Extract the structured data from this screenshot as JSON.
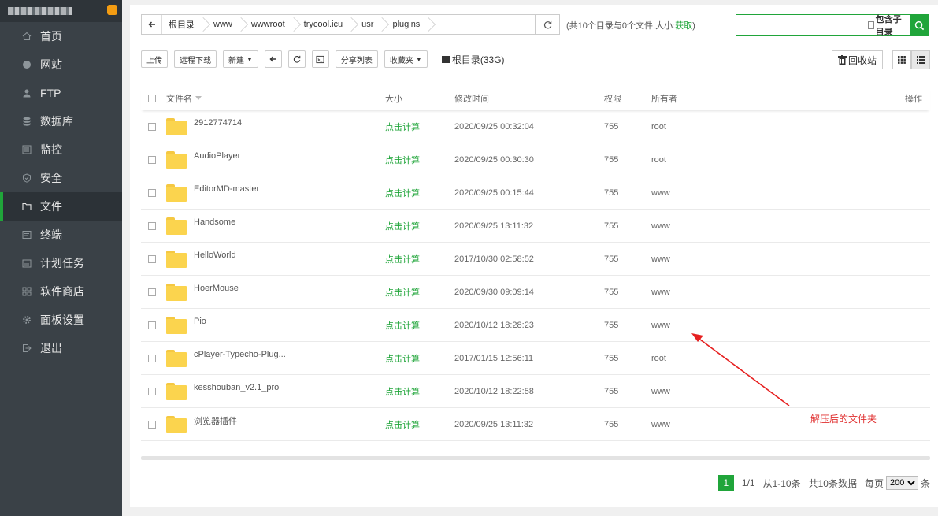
{
  "sidebar": {
    "items": [
      {
        "label": "首页",
        "icon": "home-icon"
      },
      {
        "label": "网站",
        "icon": "globe-icon"
      },
      {
        "label": "FTP",
        "icon": "ftp-icon"
      },
      {
        "label": "数据库",
        "icon": "database-icon"
      },
      {
        "label": "监控",
        "icon": "monitor-icon"
      },
      {
        "label": "安全",
        "icon": "shield-icon"
      },
      {
        "label": "文件",
        "icon": "folder-icon",
        "active": true
      },
      {
        "label": "终端",
        "icon": "terminal-icon"
      },
      {
        "label": "计划任务",
        "icon": "calendar-icon"
      },
      {
        "label": "软件商店",
        "icon": "apps-icon"
      },
      {
        "label": "面板设置",
        "icon": "gear-icon"
      },
      {
        "label": "退出",
        "icon": "logout-icon"
      }
    ]
  },
  "path": {
    "crumbs": [
      "根目录",
      "www",
      "wwwroot",
      "trycool.icu",
      "usr",
      "plugins"
    ],
    "info_prefix": "(共10个目录与0个文件,大小:",
    "info_link": "获取",
    "info_suffix": ")"
  },
  "search": {
    "value": "",
    "subdir_label": "包含子目录"
  },
  "toolbar": {
    "upload": "上传",
    "remote_download": "远程下载",
    "new": "新建",
    "share_list": "分享列表",
    "favorites": "收藏夹",
    "disk": "根目录(33G)",
    "recycle": "回收站"
  },
  "table": {
    "headers": {
      "name": "文件名",
      "size": "大小",
      "mtime": "修改时间",
      "perm": "权限",
      "owner": "所有者",
      "op": "操作"
    },
    "rows": [
      {
        "name": "2912774714",
        "size": "点击计算",
        "mtime": "2020/09/25 00:32:04",
        "perm": "755",
        "owner": "root"
      },
      {
        "name": "AudioPlayer",
        "size": "点击计算",
        "mtime": "2020/09/25 00:30:30",
        "perm": "755",
        "owner": "root"
      },
      {
        "name": "EditorMD-master",
        "size": "点击计算",
        "mtime": "2020/09/25 00:15:44",
        "perm": "755",
        "owner": "www"
      },
      {
        "name": "Handsome",
        "size": "点击计算",
        "mtime": "2020/09/25 13:11:32",
        "perm": "755",
        "owner": "www"
      },
      {
        "name": "HelloWorld",
        "size": "点击计算",
        "mtime": "2017/10/30 02:58:52",
        "perm": "755",
        "owner": "www"
      },
      {
        "name": "HoerMouse",
        "size": "点击计算",
        "mtime": "2020/09/30 09:09:14",
        "perm": "755",
        "owner": "www"
      },
      {
        "name": "Pio",
        "size": "点击计算",
        "mtime": "2020/10/12 18:28:23",
        "perm": "755",
        "owner": "www"
      },
      {
        "name": "cPlayer-Typecho-Plug...",
        "size": "点击计算",
        "mtime": "2017/01/15 12:56:11",
        "perm": "755",
        "owner": "root"
      },
      {
        "name": "kesshouban_v2.1_pro",
        "size": "点击计算",
        "mtime": "2020/10/12 18:22:58",
        "perm": "755",
        "owner": "www"
      },
      {
        "name": "浏览器插件",
        "size": "点击计算",
        "mtime": "2020/09/25 13:11:32",
        "perm": "755",
        "owner": "www"
      }
    ]
  },
  "pager": {
    "current": "1",
    "pages": "1/1",
    "range": "从1-10条",
    "total": "共10条数据",
    "per_page_label": "每页",
    "per_page_value": "200",
    "per_page_unit": "条"
  },
  "annotation": {
    "text": "解压后的文件夹",
    "color": "#e03030"
  },
  "colors": {
    "accent": "#20a53a",
    "sidebar_bg": "#3a4147"
  }
}
